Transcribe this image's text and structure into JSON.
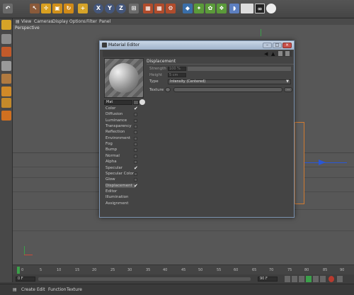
{
  "viewport_menu": [
    "View",
    "Cameras",
    "Display",
    "Options",
    "Filter",
    "Panel"
  ],
  "viewport_label": "Perspective",
  "material_editor": {
    "title": "Material Editor",
    "material_name": "Mat",
    "channels": [
      {
        "label": "Color",
        "checked": true
      },
      {
        "label": "Diffusion",
        "checked": false
      },
      {
        "label": "Luminance",
        "checked": false
      },
      {
        "label": "Transparency",
        "checked": false
      },
      {
        "label": "Reflection",
        "checked": false
      },
      {
        "label": "Environment",
        "checked": false
      },
      {
        "label": "Fog",
        "checked": false
      },
      {
        "label": "Bump",
        "checked": false
      },
      {
        "label": "Normal",
        "checked": false
      },
      {
        "label": "Alpha",
        "checked": false
      },
      {
        "label": "Specular",
        "checked": true
      },
      {
        "label": "Specular Color",
        "checked": false
      },
      {
        "label": "Glow",
        "checked": false
      },
      {
        "label": "Displacement",
        "checked": true,
        "selected": true
      },
      {
        "label": "Editor",
        "checked": null
      },
      {
        "label": "Illumination",
        "checked": null
      },
      {
        "label": "Assignment",
        "checked": null
      }
    ],
    "section_title": "Displacement",
    "strength_label": "Strength",
    "strength_value": "100 %",
    "height_label": "Height",
    "height_value": "5 cm",
    "type_label": "Type",
    "type_value": "Intensity (Centered)",
    "texture_label": "Texture",
    "texture_ellipsis": "..."
  },
  "timeline": {
    "ticks": [
      "0",
      "5",
      "10",
      "15",
      "20",
      "25",
      "30",
      "35",
      "40",
      "45",
      "50",
      "55",
      "60",
      "65",
      "70",
      "75",
      "80",
      "85",
      "90"
    ],
    "start_field": "0 F",
    "end_field": "90 F"
  },
  "bottom_menu": [
    "Create",
    "Edit",
    "Function",
    "Texture"
  ],
  "colors": {
    "accent_title": "#b0c0d6",
    "close": "#c8504a"
  }
}
